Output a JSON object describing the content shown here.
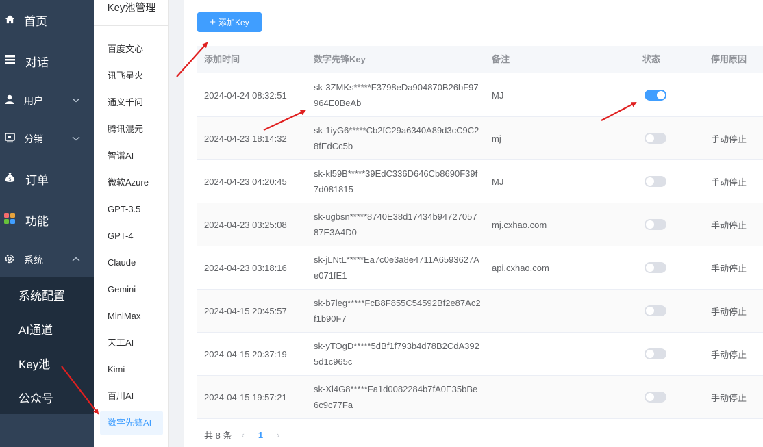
{
  "sidebar": {
    "menu": [
      {
        "label": "首页",
        "icon": "home-icon"
      },
      {
        "label": "对话",
        "icon": "list-icon"
      },
      {
        "label": "用户",
        "icon": "user-icon"
      },
      {
        "label": "分销",
        "icon": "distribution-icon"
      },
      {
        "label": "订单",
        "icon": "money-bag-icon"
      },
      {
        "label": "功能",
        "icon": "apps-grid-icon"
      },
      {
        "label": "系统",
        "icon": "gear-icon"
      }
    ],
    "submenu": [
      "系统配置",
      "AI通道",
      "Key池",
      "公众号"
    ]
  },
  "pool": {
    "title": "Key池管理",
    "items": [
      "百度文心",
      "讯飞星火",
      "通义千问",
      "腾讯混元",
      "智谱AI",
      "微软Azure",
      "GPT-3.5",
      "GPT-4",
      "Claude",
      "Gemini",
      "MiniMax",
      "天工AI",
      "Kimi",
      "百川AI",
      "数字先锋AI"
    ]
  },
  "main": {
    "add_button": "添加Key",
    "columns": [
      "添加时间",
      "数字先锋Key",
      "备注",
      "状态",
      "停用原因"
    ],
    "rows": [
      {
        "time": "2024-04-24 08:32:51",
        "key": "sk-3ZMKs*****F3798eDa904870B26bF97964E0BeAb",
        "note": "MJ",
        "enabled": true,
        "reason": ""
      },
      {
        "time": "2024-04-23 18:14:32",
        "key": "sk-1iyG6*****Cb2fC29a6340A89d3cC9C28fEdCc5b",
        "note": "mj",
        "enabled": false,
        "reason": "手动停止"
      },
      {
        "time": "2024-04-23 04:20:45",
        "key": "sk-kl59B*****39EdC336D646Cb8690F39f7d081815",
        "note": "MJ",
        "enabled": false,
        "reason": "手动停止"
      },
      {
        "time": "2024-04-23 03:25:08",
        "key": "sk-ugbsn*****8740E38d17434b9472705787E3A4D0",
        "note": "mj.cxhao.com",
        "enabled": false,
        "reason": "手动停止"
      },
      {
        "time": "2024-04-23 03:18:16",
        "key": "sk-jLNtL*****Ea7c0e3a8e4711A6593627Ae071fE1",
        "note": "api.cxhao.com",
        "enabled": false,
        "reason": "手动停止"
      },
      {
        "time": "2024-04-15 20:45:57",
        "key": "sk-b7leg*****FcB8F855C54592Bf2e87Ac2f1b90F7",
        "note": "",
        "enabled": false,
        "reason": "手动停止"
      },
      {
        "time": "2024-04-15 20:37:19",
        "key": "sk-yTOgD*****5dBf1f793b4d78B2CdA3925d1c965c",
        "note": "",
        "enabled": false,
        "reason": "手动停止"
      },
      {
        "time": "2024-04-15 19:57:21",
        "key": "sk-Xl4G8*****Fa1d0082284b7fA0E35bBe6c9c77Fa",
        "note": "",
        "enabled": false,
        "reason": "手动停止"
      }
    ],
    "pager": {
      "total": "共 8 条",
      "current": "1",
      "prev": "‹",
      "next": "›"
    }
  },
  "colors": {
    "primary": "#409eff",
    "sidebar_bg": "#304156",
    "submenu_bg": "#1f2d3d",
    "arrow": "#e02020"
  }
}
